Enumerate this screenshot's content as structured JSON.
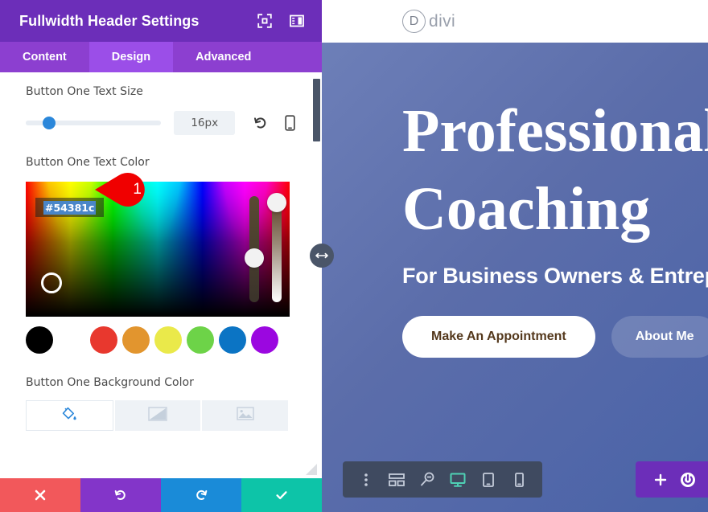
{
  "settings_panel": {
    "title": "Fullwidth Header Settings",
    "header_icons": [
      {
        "name": "focus-target-icon",
        "label": "Focus"
      },
      {
        "name": "panel-layout-icon",
        "label": "Layout"
      }
    ],
    "tabs": [
      {
        "label": "Content",
        "active": false
      },
      {
        "label": "Design",
        "active": true
      },
      {
        "label": "Advanced",
        "active": false
      }
    ],
    "text_size_field": {
      "label": "Button One Text Size",
      "value": "16px",
      "slider_percent": 17,
      "reset_icon": "undo-icon",
      "device_icon": "mobile-icon"
    },
    "text_color_field": {
      "label": "Button One Text Color",
      "hex_value": "#54381c",
      "swatches": [
        {
          "name": "swatch-black",
          "color": "#000000"
        },
        {
          "name": "swatch-white",
          "color": "#ffffff"
        },
        {
          "name": "swatch-red",
          "color": "#e8382e"
        },
        {
          "name": "swatch-orange",
          "color": "#e2952e"
        },
        {
          "name": "swatch-yellow",
          "color": "#eae94a"
        },
        {
          "name": "swatch-green",
          "color": "#6dd348"
        },
        {
          "name": "swatch-blue",
          "color": "#0b74c4"
        },
        {
          "name": "swatch-purple",
          "color": "#9b07e0"
        }
      ]
    },
    "background_color_field": {
      "label": "Button One Background Color",
      "tabs": [
        {
          "name": "bgtab-solid",
          "icon": "paint-bucket-icon",
          "active": true
        },
        {
          "name": "bgtab-gradient",
          "icon": "gradient-icon",
          "active": false
        },
        {
          "name": "bgtab-image",
          "icon": "image-icon",
          "active": false
        }
      ]
    },
    "actions": [
      {
        "name": "cancel-button",
        "icon": "close-icon",
        "color": "#f2585b"
      },
      {
        "name": "undo-button",
        "icon": "undo-icon",
        "color": "#8335c9"
      },
      {
        "name": "redo-button",
        "icon": "redo-icon",
        "color": "#1a8bd8"
      },
      {
        "name": "save-button",
        "icon": "check-icon",
        "color": "#0dc4a8"
      }
    ]
  },
  "annotation": {
    "badge_number": "1",
    "badge_color": "#f00000"
  },
  "preview": {
    "logo": {
      "mark": "D",
      "word": "divi"
    },
    "hero": {
      "title_line_1": "Professional",
      "title_line_2": "Coaching",
      "subtitle": "For Business Owners & Entrepreneurs",
      "buttons": [
        {
          "name": "make-appointment-button",
          "label": "Make An Appointment",
          "text_color": "#54381c",
          "bg": "#ffffff"
        },
        {
          "name": "about-me-button",
          "label": "About Me",
          "text_color": "#ffffff",
          "bg": "rgba(255,255,255,.17)"
        }
      ]
    },
    "builder_toolbar": [
      {
        "name": "more-options-icon",
        "active": false
      },
      {
        "name": "wireframe-view-icon",
        "active": false
      },
      {
        "name": "zoom-out-view-icon",
        "active": false
      },
      {
        "name": "desktop-view-icon",
        "active": true
      },
      {
        "name": "tablet-view-icon",
        "active": false
      },
      {
        "name": "phone-view-icon",
        "active": false
      }
    ],
    "builder_right": [
      {
        "name": "add-section-icon"
      },
      {
        "name": "power-toggle-icon"
      }
    ]
  }
}
